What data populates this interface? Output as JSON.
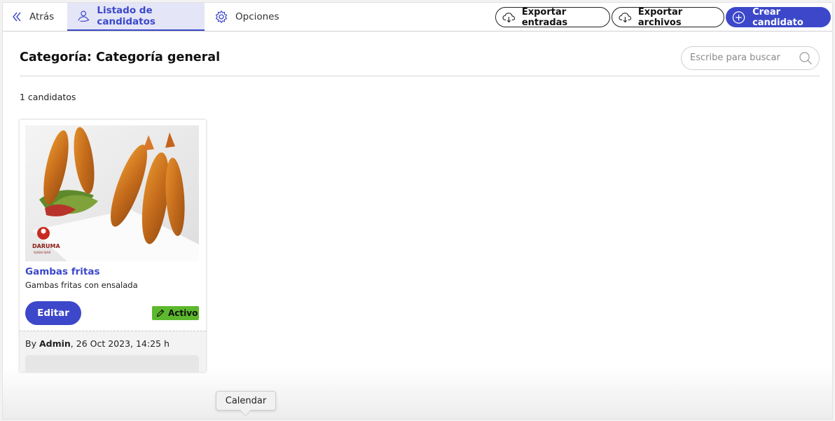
{
  "nav": {
    "back_label": "Atrás",
    "list_label": "Listado de candidatos",
    "options_label": "Opciones"
  },
  "toolbar": {
    "export_entries_label": "Exportar entradas",
    "export_files_label": "Exportar archivos",
    "create_label": "Crear candidato"
  },
  "page": {
    "title": "Categoría: Categoría general",
    "count_text": "1 candidatos"
  },
  "search": {
    "placeholder": "Escribe para buscar"
  },
  "candidates": [
    {
      "title": "Gambas fritas",
      "description": "Gambas fritas con ensalada",
      "edit_label": "Editar",
      "status": "Activo",
      "by_prefix": "By ",
      "author": "Admin",
      "date": ", 26 Oct 2023, 14:25 h",
      "logo_text": "DARUMA",
      "logo_subtext": "SUSHI BAR"
    }
  ],
  "tooltip": {
    "text": "Calendar"
  },
  "colors": {
    "accent": "#3c48c9",
    "active_badge": "#5cb82c",
    "nav_active_bg": "#e4e6f7"
  },
  "icons": {
    "back": "double-chevron-left-icon",
    "list": "user-hand-icon",
    "options": "gear-icon",
    "export": "cloud-download-icon",
    "create": "plus-circle-icon",
    "search": "search-icon",
    "status": "pencil-icon"
  }
}
